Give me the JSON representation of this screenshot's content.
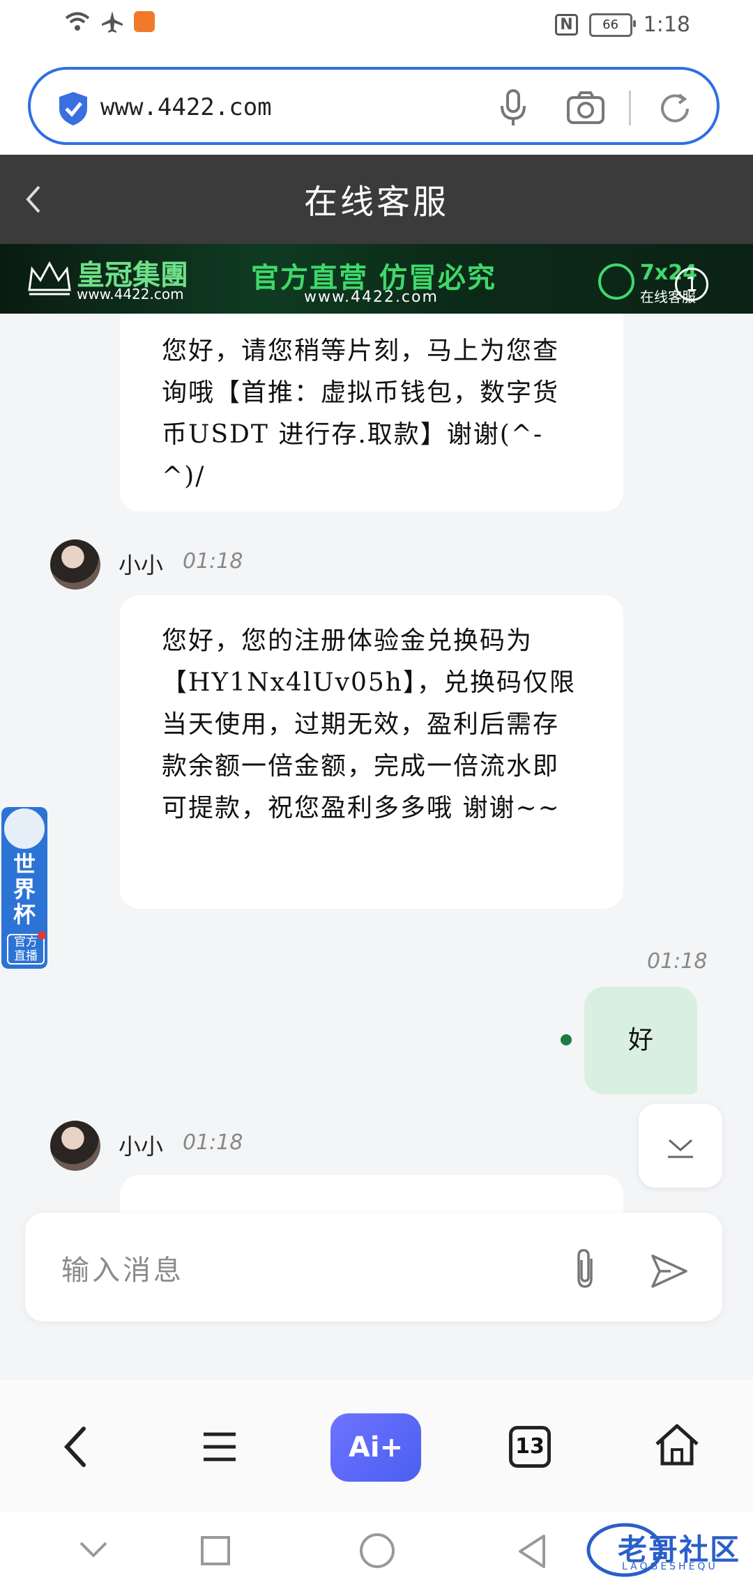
{
  "status_bar": {
    "time": "1:18",
    "battery": "66",
    "nfc_label": "N"
  },
  "browser": {
    "url": "www.4422.com"
  },
  "header": {
    "title": "在线客服"
  },
  "banner": {
    "brand_name": "皇冠集團",
    "brand_url": "www.4422.com",
    "slogan": "官方直营  仿冒必究",
    "slogan_url": "www.4422.com",
    "support_hours": "7x24",
    "support_label": "在线客服",
    "close_label": "1"
  },
  "messages": [
    {
      "type": "agent",
      "text": "您好，请您稍等片刻，马上为您查询哦【首推：虚拟币钱包，数字货币USDT 进行存.取款】谢谢(^-^)/"
    },
    {
      "type": "agent",
      "sender": "小小",
      "time": "01:18",
      "text": "您好，您的注册体验金兑换码为【HY1Nx4lUv05h】，兑换码仅限当天使用，过期无效，盈利后需存款余额一倍金额，完成一倍流水即可提款，祝您盈利多多哦 谢谢~~"
    },
    {
      "type": "self",
      "time": "01:18",
      "text": "好"
    },
    {
      "type": "agent",
      "sender": "小小",
      "time": "01:18",
      "text": ""
    }
  ],
  "floating_promo": {
    "title": "世界杯",
    "live_label": "官方直播"
  },
  "composer": {
    "placeholder": "输入消息"
  },
  "bottom_nav": {
    "ai_label": "Ai+",
    "tab_count": "13"
  },
  "watermark": {
    "text": "老哥社区",
    "sub": "LAOGESHEQU"
  }
}
